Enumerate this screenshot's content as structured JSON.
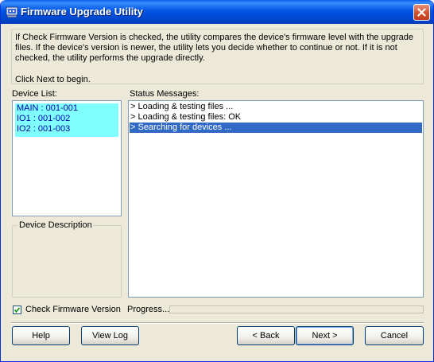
{
  "window": {
    "title": "Firmware Upgrade Utility"
  },
  "info": {
    "text": "If Check Firmware Version is checked, the utility compares the device's firmware level with the upgrade files. If the device's version is newer, the utility lets you decide whether to continue or not. If it is not checked, the utility performs the upgrade directly.",
    "begin": "Click Next to begin."
  },
  "device_list": {
    "label": "Device List:",
    "items": [
      "MAIN : 001-001",
      "IO1 : 001-002",
      "IO2 : 001-003"
    ]
  },
  "device_description": {
    "label": "Device Description"
  },
  "status": {
    "label": "Status Messages:",
    "messages": [
      "> Loading & testing files ...",
      "> Loading & testing files: OK",
      "> Searching for devices ..."
    ],
    "selected_index": 2
  },
  "options": {
    "check_firmware_label": "Check Firmware Version",
    "check_firmware_checked": true,
    "progress_label": "Progress...",
    "progress_value": 0
  },
  "buttons": {
    "help": "Help",
    "view_log": "View Log",
    "back": "< Back",
    "next": "Next >",
    "cancel": "Cancel"
  },
  "colors": {
    "title_bar": "#0054e3",
    "selected_device_bg": "#80ffff",
    "selected_message_bg": "#316ac5",
    "close_button": "#d0512f"
  }
}
